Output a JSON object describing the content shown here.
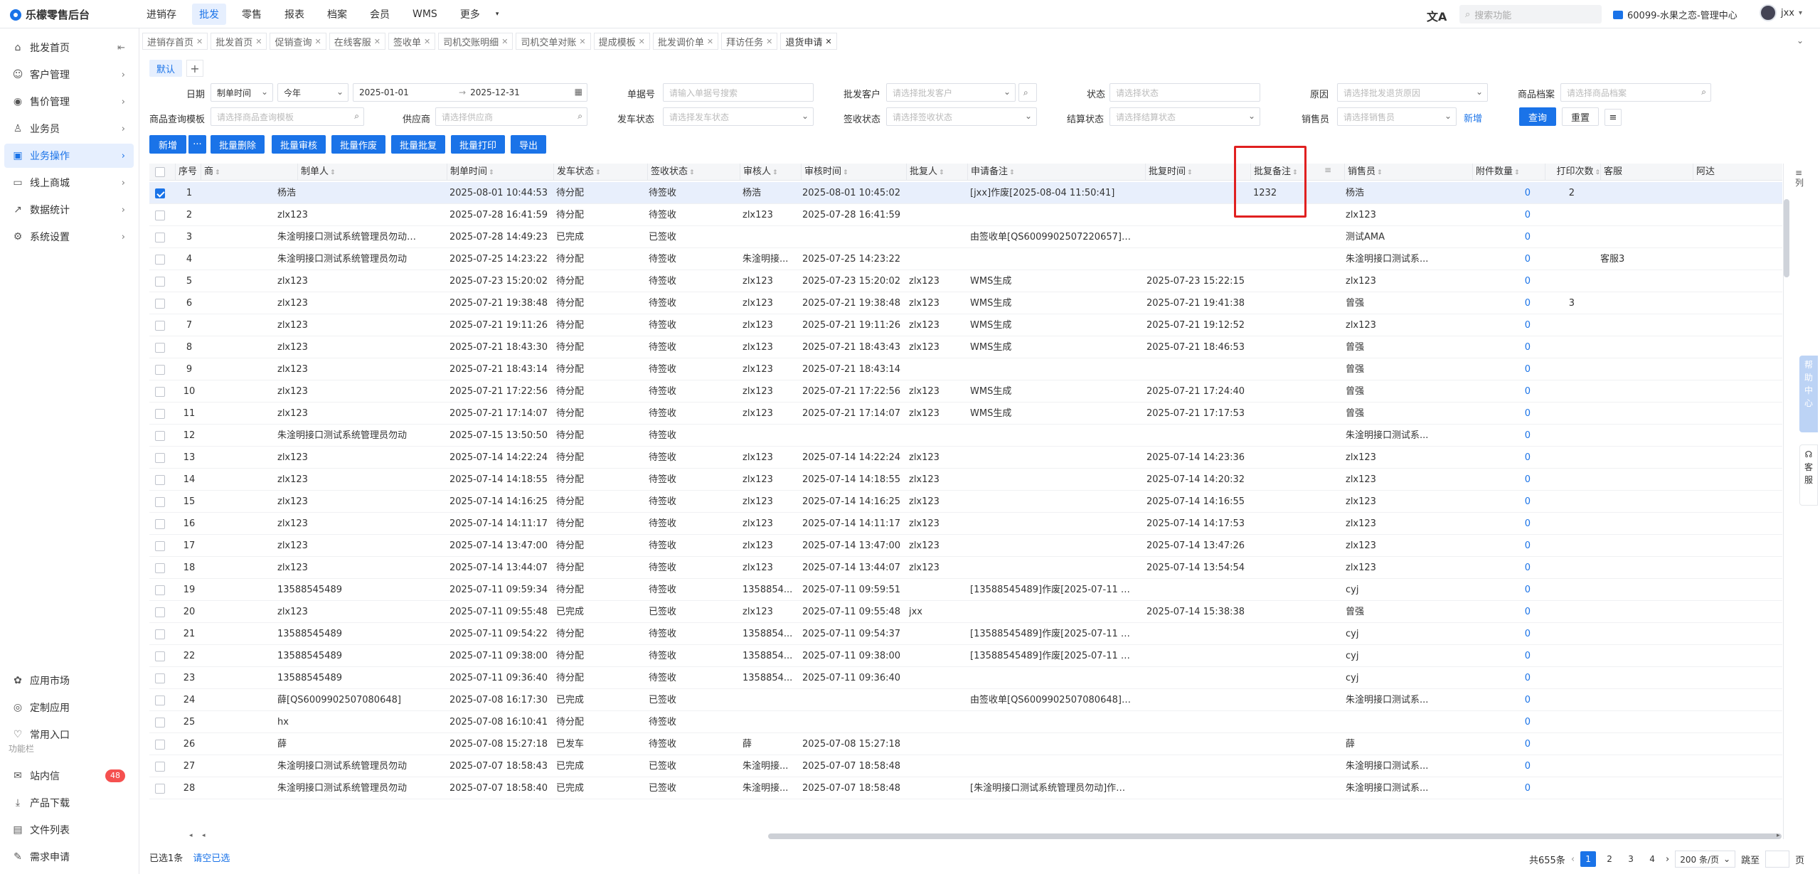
{
  "app": {
    "title": "乐檬零售后台"
  },
  "topnav": [
    "进销存",
    "批发",
    "零售",
    "报表",
    "档案",
    "会员",
    "WMS",
    "更多"
  ],
  "topnav_active": 1,
  "header": {
    "search_placeholder": "搜索功能",
    "store": "60099-水果之恋-管理中心",
    "user": "jxx"
  },
  "sidebar": {
    "items": [
      {
        "label": "批发首页",
        "icon": "⌂"
      },
      {
        "label": "客户管理",
        "icon": "☺"
      },
      {
        "label": "售价管理",
        "icon": "◉"
      },
      {
        "label": "业务员",
        "icon": "♙"
      },
      {
        "label": "业务操作",
        "icon": "▣"
      },
      {
        "label": "线上商城",
        "icon": "▭"
      },
      {
        "label": "数据统计",
        "icon": "↗"
      },
      {
        "label": "系统设置",
        "icon": "⚙"
      }
    ],
    "bottom": [
      {
        "label": "应用市场",
        "icon": "✿"
      },
      {
        "label": "定制应用",
        "icon": "◎"
      },
      {
        "label": "常用入口",
        "icon": "♡"
      }
    ],
    "section": "功能栏",
    "tools": [
      {
        "label": "站内信",
        "icon": "✉",
        "badge": "48"
      },
      {
        "label": "产品下载",
        "icon": "⤓"
      },
      {
        "label": "文件列表",
        "icon": "▤"
      },
      {
        "label": "需求申请",
        "icon": "✎"
      }
    ]
  },
  "tabs": [
    "进销存首页",
    "批发首页",
    "促销查询",
    "在线客服",
    "签收单",
    "司机交账明细",
    "司机交单对账",
    "提成模板",
    "批发调价单",
    "拜访任务",
    "退货申请"
  ],
  "view_tab": "默认",
  "filters": {
    "date_label": "日期",
    "date_type": "制单时间",
    "date_range": "今年",
    "date_start": "2025-01-01",
    "date_end": "2025-12-31",
    "doc_label": "单据号",
    "doc_ph": "请输入单据号搜索",
    "client_label": "批发客户",
    "client_ph": "请选择批发客户",
    "status_label": "状态",
    "status_ph": "请选择状态",
    "reason_label": "原因",
    "reason_ph": "请选择批发退货原因",
    "goods_label": "商品档案",
    "goods_ph": "请选择商品档案",
    "tpl_label": "商品查询模板",
    "tpl_ph": "请选择商品查询模板",
    "supplier_label": "供应商",
    "supplier_ph": "请选择供应商",
    "ship_label": "发车状态",
    "ship_ph": "请选择发车状态",
    "sign_label": "签收状态",
    "sign_ph": "请选择签收状态",
    "settle_label": "结算状态",
    "settle_ph": "请选择结算状态",
    "sales_label": "销售员",
    "sales_ph": "请选择销售员",
    "add_link": "新增",
    "query": "查询",
    "reset": "重置"
  },
  "actions": [
    "新增",
    "批量删除",
    "批量审核",
    "批量作废",
    "批量批复",
    "批量打印",
    "导出"
  ],
  "columns": [
    "序号",
    "商",
    "制单人",
    "制单时间",
    "发车状态",
    "签收状态",
    "审核人",
    "审核时间",
    "批复人",
    "申请备注",
    "批复时间",
    "批复备注",
    "销售员",
    "附件数量",
    "打印次数",
    "客服",
    "阿达"
  ],
  "rows": [
    [
      "1",
      "杨浩",
      "2025-08-01 10:44:53",
      "待分配",
      "待签收",
      "杨浩",
      "2025-08-01 10:45:02",
      "",
      "[jxx]作废[2025-08-04 11:50:41]",
      "",
      "1232",
      "杨浩",
      "0",
      "2",
      ""
    ],
    [
      "2",
      "zlx123",
      "2025-07-28 16:41:59",
      "待分配",
      "待签收",
      "zlx123",
      "2025-07-28 16:41:59",
      "",
      "",
      "",
      "",
      "zlx123",
      "0",
      "",
      ""
    ],
    [
      "3",
      "朱淦明接口测试系统管理员勿动[QS6...",
      "2025-07-28 14:49:23",
      "已完成",
      "已签收",
      "",
      "",
      "",
      "由签收单[QS6009902507220657]生成",
      "",
      "",
      "测试AMA",
      "0",
      "",
      ""
    ],
    [
      "4",
      "朱淦明接口测试系统管理员勿动",
      "2025-07-25 14:23:22",
      "待分配",
      "待签收",
      "朱淦明接...",
      "2025-07-25 14:23:22",
      "",
      "",
      "",
      "",
      "朱淦明接口测试系...",
      "0",
      "",
      "客服3"
    ],
    [
      "5",
      "zlx123",
      "2025-07-23 15:20:02",
      "待分配",
      "待签收",
      "zlx123",
      "2025-07-23 15:20:02",
      "zlx123",
      "WMS生成",
      "2025-07-23 15:22:15",
      "",
      "zlx123",
      "0",
      "",
      ""
    ],
    [
      "6",
      "zlx123",
      "2025-07-21 19:38:48",
      "待分配",
      "待签收",
      "zlx123",
      "2025-07-21 19:38:48",
      "zlx123",
      "WMS生成",
      "2025-07-21 19:41:38",
      "",
      "曾强",
      "0",
      "3",
      ""
    ],
    [
      "7",
      "zlx123",
      "2025-07-21 19:11:26",
      "待分配",
      "待签收",
      "zlx123",
      "2025-07-21 19:11:26",
      "zlx123",
      "WMS生成",
      "2025-07-21 19:12:52",
      "",
      "zlx123",
      "0",
      "",
      ""
    ],
    [
      "8",
      "zlx123",
      "2025-07-21 18:43:30",
      "待分配",
      "待签收",
      "zlx123",
      "2025-07-21 18:43:43",
      "zlx123",
      "WMS生成",
      "2025-07-21 18:46:53",
      "",
      "曾强",
      "0",
      "",
      ""
    ],
    [
      "9",
      "zlx123",
      "2025-07-21 18:43:14",
      "待分配",
      "待签收",
      "zlx123",
      "2025-07-21 18:43:14",
      "",
      "",
      "",
      "",
      "曾强",
      "0",
      "",
      ""
    ],
    [
      "10",
      "zlx123",
      "2025-07-21 17:22:56",
      "待分配",
      "待签收",
      "zlx123",
      "2025-07-21 17:22:56",
      "zlx123",
      "WMS生成",
      "2025-07-21 17:24:40",
      "",
      "曾强",
      "0",
      "",
      ""
    ],
    [
      "11",
      "zlx123",
      "2025-07-21 17:14:07",
      "待分配",
      "待签收",
      "zlx123",
      "2025-07-21 17:14:07",
      "zlx123",
      "WMS生成",
      "2025-07-21 17:17:53",
      "",
      "曾强",
      "0",
      "",
      ""
    ],
    [
      "12",
      "朱淦明接口测试系统管理员勿动",
      "2025-07-15 13:50:50",
      "待分配",
      "待签收",
      "",
      "",
      "",
      "",
      "",
      "",
      "朱淦明接口测试系...",
      "0",
      "",
      ""
    ],
    [
      "13",
      "zlx123",
      "2025-07-14 14:22:24",
      "待分配",
      "待签收",
      "zlx123",
      "2025-07-14 14:22:24",
      "zlx123",
      "",
      "2025-07-14 14:23:36",
      "",
      "zlx123",
      "0",
      "",
      ""
    ],
    [
      "14",
      "zlx123",
      "2025-07-14 14:18:55",
      "待分配",
      "待签收",
      "zlx123",
      "2025-07-14 14:18:55",
      "zlx123",
      "",
      "2025-07-14 14:20:32",
      "",
      "zlx123",
      "0",
      "",
      ""
    ],
    [
      "15",
      "zlx123",
      "2025-07-14 14:16:25",
      "待分配",
      "待签收",
      "zlx123",
      "2025-07-14 14:16:25",
      "zlx123",
      "",
      "2025-07-14 14:16:55",
      "",
      "zlx123",
      "0",
      "",
      ""
    ],
    [
      "16",
      "zlx123",
      "2025-07-14 14:11:17",
      "待分配",
      "待签收",
      "zlx123",
      "2025-07-14 14:11:17",
      "zlx123",
      "",
      "2025-07-14 14:17:53",
      "",
      "zlx123",
      "0",
      "",
      ""
    ],
    [
      "17",
      "zlx123",
      "2025-07-14 13:47:00",
      "待分配",
      "待签收",
      "zlx123",
      "2025-07-14 13:47:00",
      "zlx123",
      "",
      "2025-07-14 13:47:26",
      "",
      "zlx123",
      "0",
      "",
      ""
    ],
    [
      "18",
      "zlx123",
      "2025-07-14 13:44:07",
      "待分配",
      "待签收",
      "zlx123",
      "2025-07-14 13:44:07",
      "zlx123",
      "",
      "2025-07-14 13:54:54",
      "",
      "zlx123",
      "0",
      "",
      ""
    ],
    [
      "19",
      "13588545489",
      "2025-07-11 09:59:34",
      "待分配",
      "待签收",
      "1358854...",
      "2025-07-11 09:59:51",
      "",
      "[13588545489]作废[2025-07-11 09:...",
      "",
      "",
      "cyj",
      "0",
      "",
      ""
    ],
    [
      "20",
      "zlx123",
      "2025-07-11 09:55:48",
      "已完成",
      "已签收",
      "zlx123",
      "2025-07-11 09:55:48",
      "jxx",
      "",
      "2025-07-14 15:38:38",
      "",
      "曾强",
      "0",
      "",
      ""
    ],
    [
      "21",
      "13588545489",
      "2025-07-11 09:54:22",
      "待分配",
      "待签收",
      "1358854...",
      "2025-07-11 09:54:37",
      "",
      "[13588545489]作废[2025-07-11 09:...",
      "",
      "",
      "cyj",
      "0",
      "",
      ""
    ],
    [
      "22",
      "13588545489",
      "2025-07-11 09:38:00",
      "待分配",
      "待签收",
      "1358854...",
      "2025-07-11 09:38:00",
      "",
      "[13588545489]作废[2025-07-11 09:...",
      "",
      "",
      "cyj",
      "0",
      "",
      ""
    ],
    [
      "23",
      "13588545489",
      "2025-07-11 09:36:40",
      "待分配",
      "待签收",
      "1358854...",
      "2025-07-11 09:36:40",
      "",
      "",
      "",
      "",
      "cyj",
      "0",
      "",
      ""
    ],
    [
      "24",
      "薛[QS6009902507080648]",
      "2025-07-08 16:17:30",
      "已完成",
      "已签收",
      "",
      "",
      "",
      "由签收单[QS6009902507080648]生成",
      "",
      "",
      "朱淦明接口测试系...",
      "0",
      "",
      ""
    ],
    [
      "25",
      "hx",
      "2025-07-08 16:10:41",
      "待分配",
      "待签收",
      "",
      "",
      "",
      "",
      "",
      "",
      "",
      "0",
      "",
      ""
    ],
    [
      "26",
      "薛",
      "2025-07-08 15:27:18",
      "已发车",
      "待签收",
      "薛",
      "2025-07-08 15:27:18",
      "",
      "",
      "",
      "",
      "薛",
      "0",
      "",
      ""
    ],
    [
      "27",
      "朱淦明接口测试系统管理员勿动",
      "2025-07-07 18:58:43",
      "已完成",
      "已签收",
      "朱淦明接...",
      "2025-07-07 18:58:48",
      "",
      "",
      "",
      "",
      "朱淦明接口测试系...",
      "0",
      "",
      ""
    ],
    [
      "28",
      "朱淦明接口测试系统管理员勿动",
      "2025-07-07 18:58:40",
      "已完成",
      "已签收",
      "朱淦明接...",
      "2025-07-07 18:58:48",
      "",
      "[朱淦明接口测试系统管理员勿动]作废[...",
      "",
      "",
      "朱淦明接口测试系...",
      "0",
      "",
      ""
    ]
  ],
  "selected_row": 0,
  "footer": {
    "selected": "已选1条",
    "clear": "请空已选",
    "total": "共655条",
    "pages": [
      "1",
      "2",
      "3",
      "4"
    ],
    "page_size": "200 条/页",
    "jump": "跳至",
    "page_unit": "页"
  },
  "rail": {
    "columns_label": "列",
    "help": [
      "帮",
      "助",
      "中",
      "心"
    ],
    "service": [
      "客",
      "服"
    ]
  }
}
